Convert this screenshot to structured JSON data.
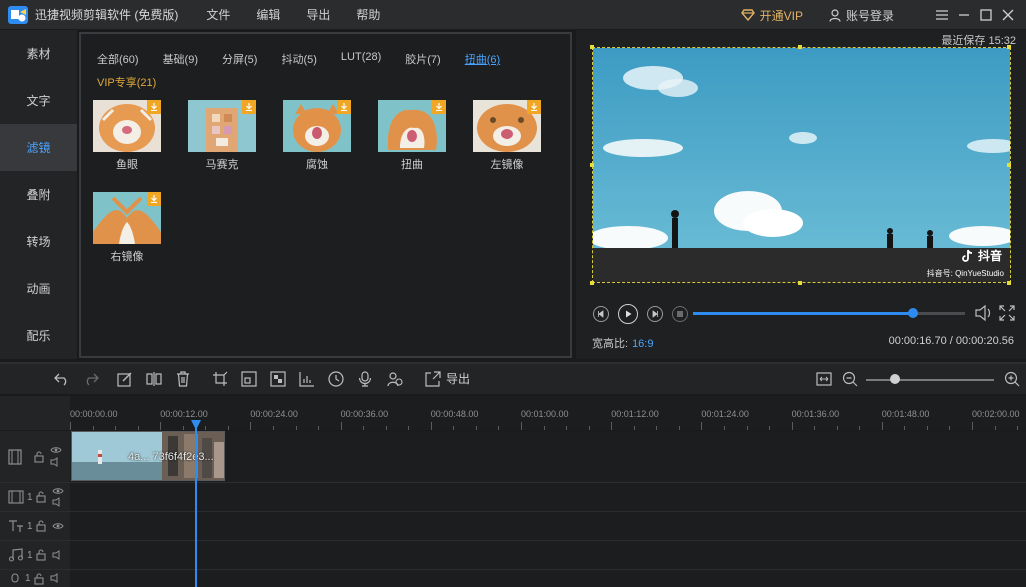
{
  "app": {
    "title": "迅捷视频剪辑软件 (免费版)",
    "menu": [
      "文件",
      "编辑",
      "导出",
      "帮助"
    ],
    "vip_label": "开通VIP",
    "account_label": "账号登录"
  },
  "nav": {
    "items": [
      {
        "label": "素材"
      },
      {
        "label": "文字"
      },
      {
        "label": "滤镜",
        "active": true
      },
      {
        "label": "叠附"
      },
      {
        "label": "转场"
      },
      {
        "label": "动画"
      },
      {
        "label": "配乐"
      }
    ]
  },
  "filters": {
    "tabs": [
      "全部(60)",
      "基础(9)",
      "分屏(5)",
      "抖动(5)",
      "LUT(28)",
      "胶片(7)",
      "扭曲(6)"
    ],
    "active_tab": "扭曲(6)",
    "vip_tab": "VIP专享(21)",
    "items": [
      {
        "label": "鱼眼"
      },
      {
        "label": "马赛克"
      },
      {
        "label": "腐蚀"
      },
      {
        "label": "扭曲"
      },
      {
        "label": "左镜像"
      },
      {
        "label": "右镜像"
      }
    ]
  },
  "preview": {
    "saved_text": "最近保存 15:32",
    "watermark_brand": "抖音",
    "watermark_id": "抖音号: QinYueStudio",
    "aspect_label": "宽高比:",
    "aspect_value": "16:9",
    "timecode": "00:00:16.70 / 00:00:20.56",
    "progress": 0.81
  },
  "timeline": {
    "export_label": "导出",
    "zoom": 0.23,
    "ruler": [
      "00:00:00.00",
      "00:00:12.00",
      "00:00:24.00",
      "00:00:36.00",
      "00:00:48.00",
      "00:01:00.00",
      "00:01:12.00",
      "00:01:24.00",
      "00:01:36.00",
      "00:01:48.00",
      "00:02:00.00"
    ],
    "clip_name": "4a... 73f6f4f2e3...",
    "track_numbers": [
      "1",
      "1",
      "1",
      "1"
    ]
  },
  "colors": {
    "accent": "#2e8cf0",
    "vip": "#e2b264",
    "background": "#1a1a1b"
  }
}
